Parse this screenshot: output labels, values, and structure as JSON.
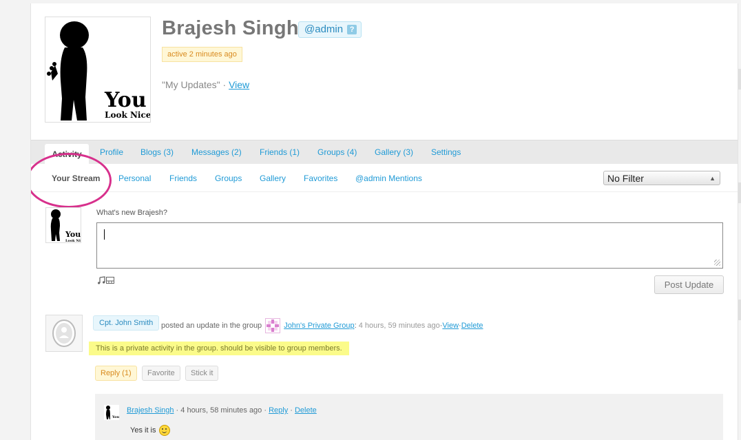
{
  "profile": {
    "name": "Brajesh Singh",
    "handle": "@admin",
    "help": "?",
    "status": "active 2 minutes ago",
    "updates_text": "\"My Updates\" · ",
    "updates_link": "View",
    "avatar_text_1": "You",
    "avatar_text_2": "Look Nice"
  },
  "main_tabs": [
    {
      "label": "Activity"
    },
    {
      "label": "Profile"
    },
    {
      "label": "Blogs (3)"
    },
    {
      "label": "Messages (2)"
    },
    {
      "label": "Friends (1)"
    },
    {
      "label": "Groups (4)"
    },
    {
      "label": "Gallery (3)"
    },
    {
      "label": "Settings"
    }
  ],
  "sub_tabs": [
    {
      "label": "Your Stream"
    },
    {
      "label": "Personal"
    },
    {
      "label": "Friends"
    },
    {
      "label": "Groups"
    },
    {
      "label": "Gallery"
    },
    {
      "label": "Favorites"
    },
    {
      "label": "@admin Mentions"
    }
  ],
  "filter": {
    "selected": "No Filter"
  },
  "post_form": {
    "prompt": "What's new Brajesh?",
    "button": "Post Update",
    "media_icons": [
      "music-icon",
      "video-icon"
    ]
  },
  "activity": {
    "user": "Cpt. John Smith",
    "action": "posted an update in the group",
    "group": "John's Private Group",
    "colon": ":",
    "time": "4 hours, 59 minutes ago",
    "sep1": " · ",
    "view": "View",
    "sep2": " · ",
    "delete": "Delete",
    "content": "This is a private activity in the group. should be visible to group members.",
    "buttons": {
      "reply": "Reply (1)",
      "favorite": "Favorite",
      "stick": "Stick it"
    }
  },
  "comment": {
    "user": "Brajesh Singh",
    "time": " · 4 hours, 58 minutes ago · ",
    "reply": "Reply",
    "sep": " · ",
    "delete": "Delete",
    "text": "Yes it is"
  },
  "colors": {
    "link": "#1f9ad6",
    "highlight": "#fbfb8a",
    "annotation": "#d7308c"
  }
}
